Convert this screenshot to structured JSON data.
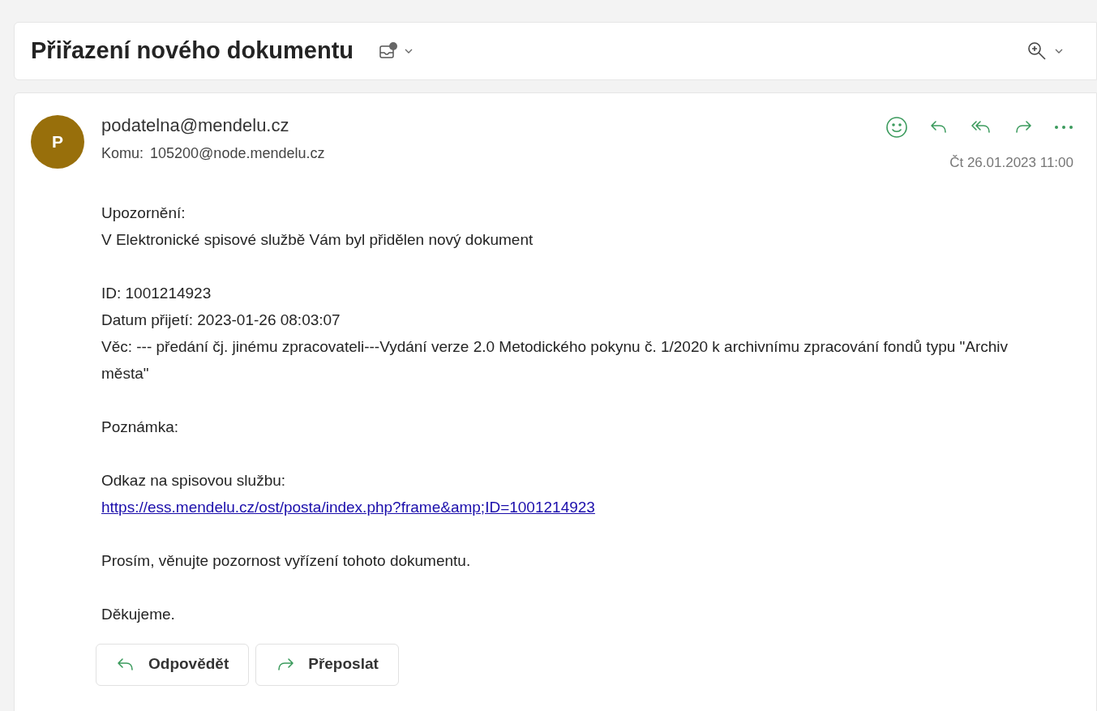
{
  "subject": "Přiřazení nového dokumentu",
  "sender": {
    "initial": "P",
    "address": "podatelna@mendelu.cz",
    "to_label": "Komu:",
    "to": "105200@node.mendelu.cz",
    "date": "Čt 26.01.2023 11:00"
  },
  "body": [
    [
      {
        "kind": "text",
        "text": "Upozornění:"
      },
      {
        "kind": "text",
        "text": "V Elektronické spisové službě Vám byl přidělen nový dokument"
      }
    ],
    [
      {
        "kind": "text",
        "text": "ID: 1001214923"
      },
      {
        "kind": "text",
        "text": "Datum přijetí: 2023-01-26 08:03:07"
      },
      {
        "kind": "text",
        "text": "Věc: --- předání čj. jinému zpracovateli---Vydání verze 2.0 Metodického pokynu č. 1/2020 k archivnímu zpracování fondů typu \"Archiv města\""
      }
    ],
    [
      {
        "kind": "text",
        "text": "Poznámka:"
      }
    ],
    [
      {
        "kind": "text",
        "text": "Odkaz na spisovou službu:"
      },
      {
        "kind": "link",
        "text": "https://ess.mendelu.cz/ost/posta/index.php?frame&amp;ID=1001214923"
      }
    ],
    [
      {
        "kind": "text",
        "text": "Prosím, věnujte pozornost vyřízení tohoto dokumentu."
      }
    ],
    [
      {
        "kind": "text",
        "text": "Děkujeme."
      }
    ]
  ],
  "buttons": [
    {
      "kind": "reply",
      "label": "Odpovědět"
    },
    {
      "kind": "forward",
      "label": "Přeposlat"
    }
  ]
}
